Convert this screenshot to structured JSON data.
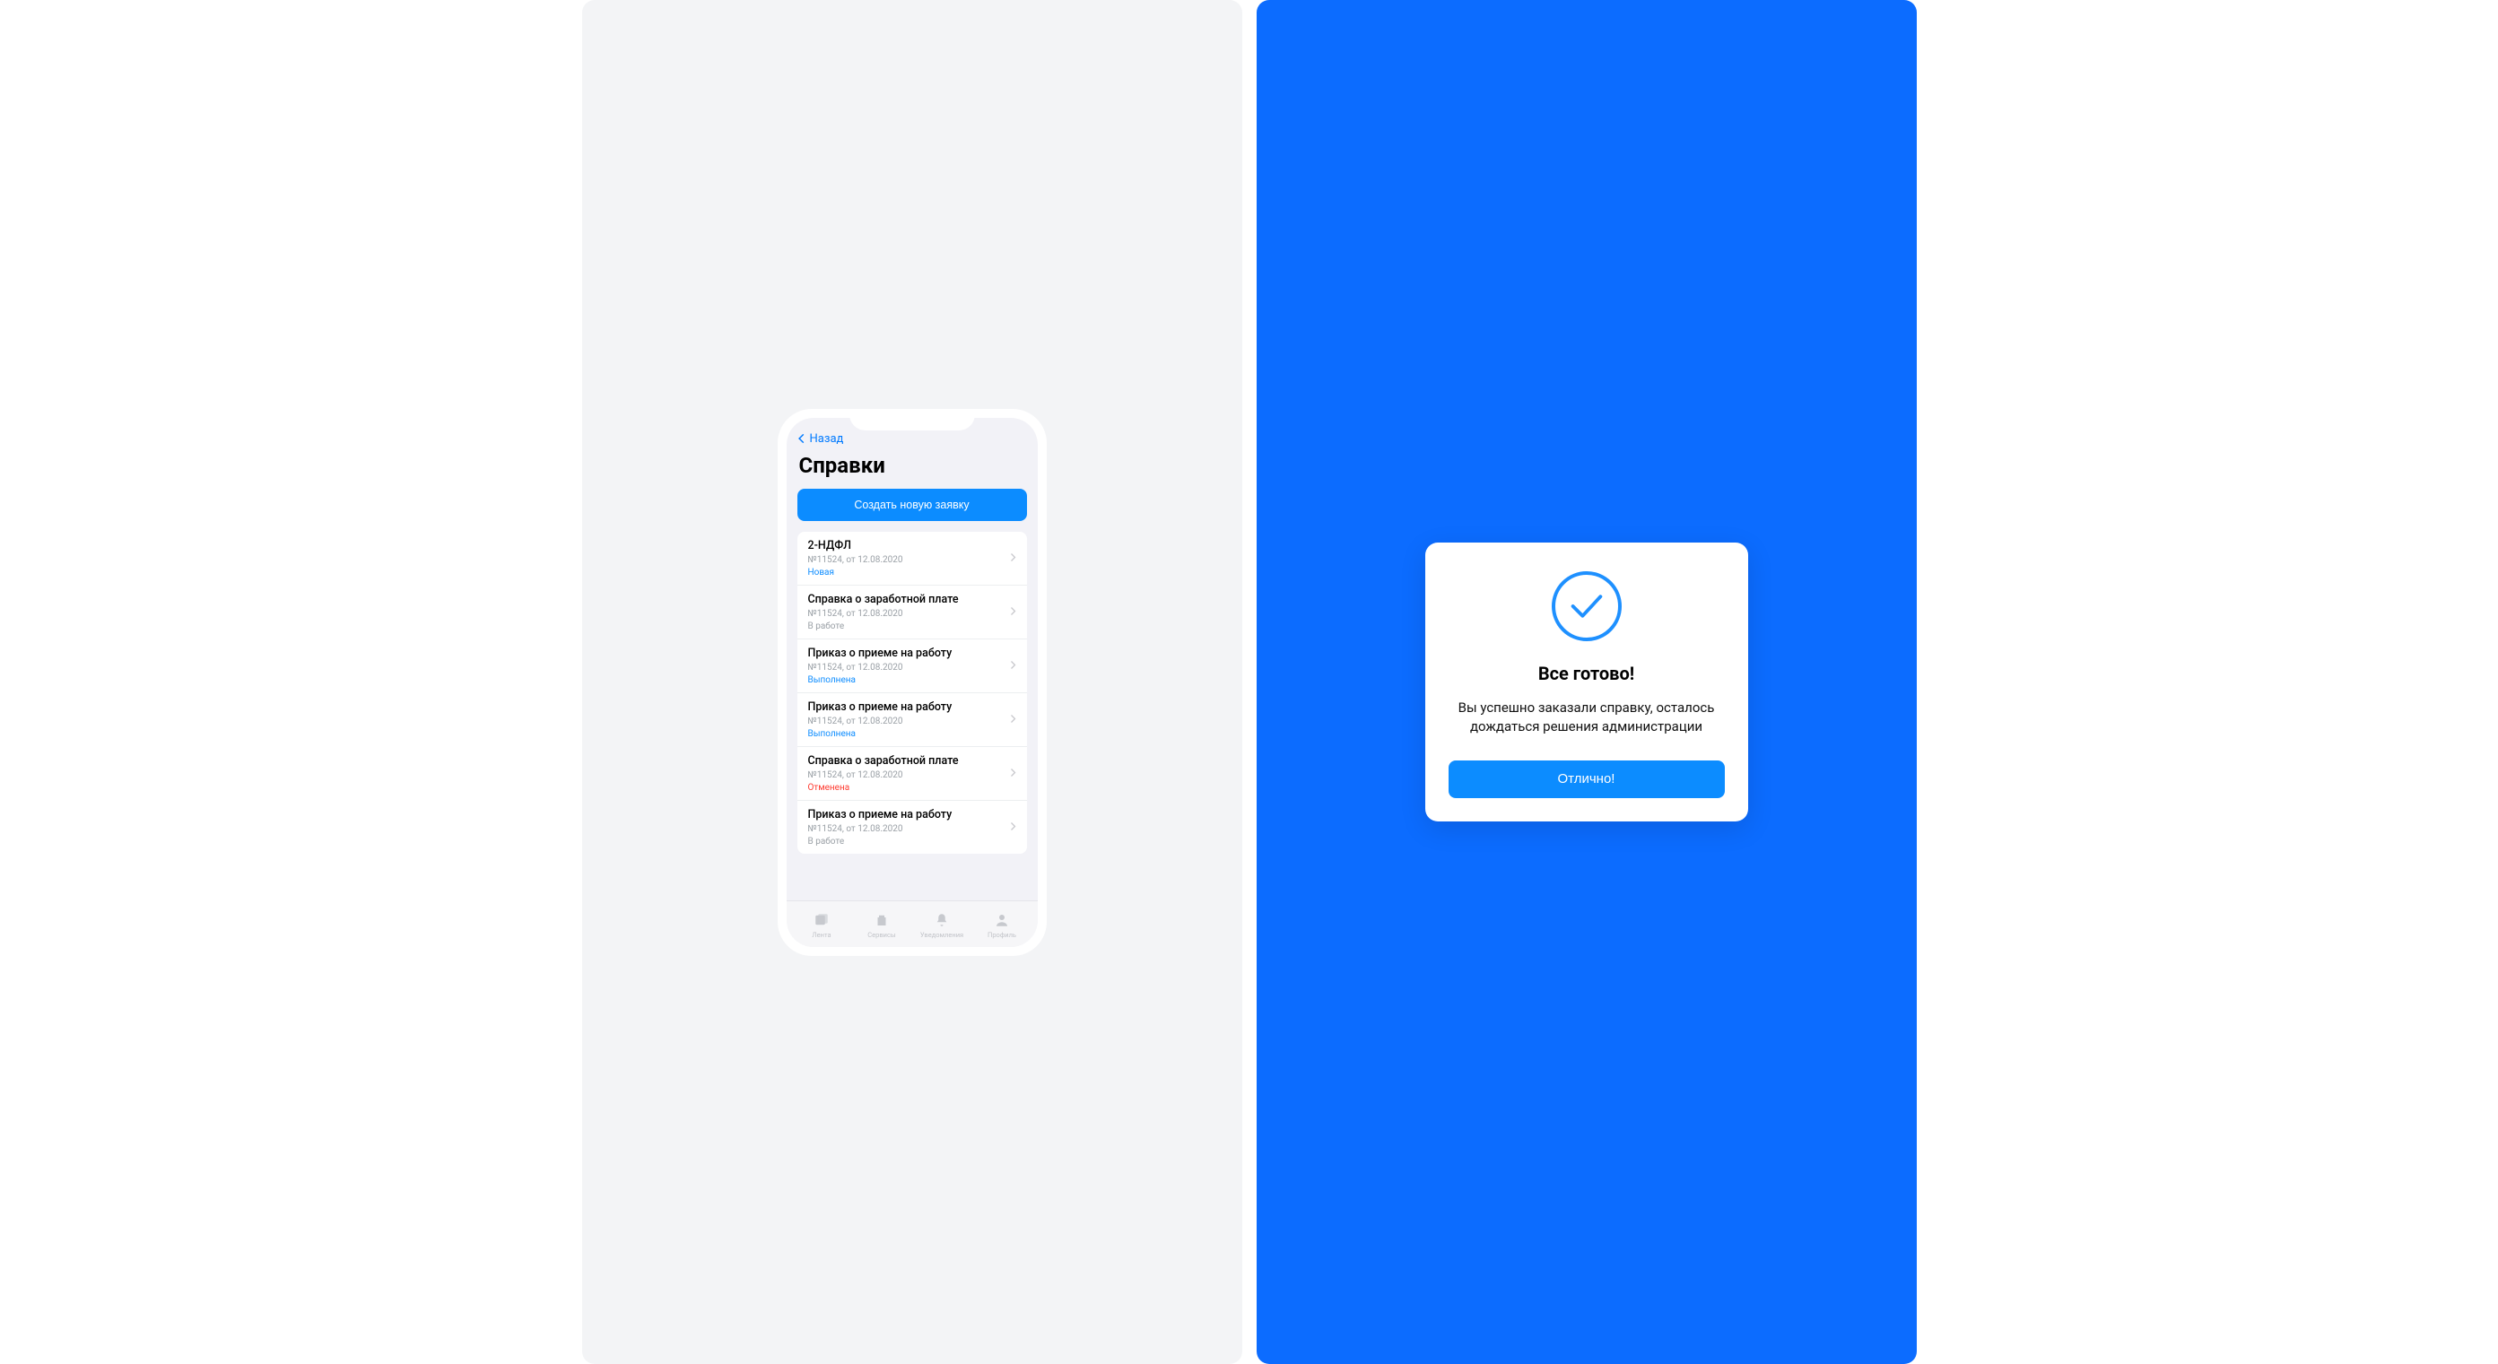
{
  "colors": {
    "accent": "#0c8cff",
    "panel_bg": "#0c6cff",
    "ios_blue": "#007aff",
    "red": "#ff3b30",
    "gray": "#9aa0a6"
  },
  "phone": {
    "back_label": "Назад",
    "title": "Справки",
    "primary_button": "Создать новую заявку",
    "requests": [
      {
        "title": "2-НДФЛ",
        "subtitle": "№11524, от 12.08.2020",
        "status": "Новая",
        "status_style": "stat-blue"
      },
      {
        "title": "Справка о заработной плате",
        "subtitle": "№11524, от 12.08.2020",
        "status": "В работе",
        "status_style": "stat-gray"
      },
      {
        "title": "Приказ о приеме на работу",
        "subtitle": "№11524, от 12.08.2020",
        "status": "Выполнена",
        "status_style": "stat-blue"
      },
      {
        "title": "Приказ о приеме на работу",
        "subtitle": "№11524, от 12.08.2020",
        "status": "Выполнена",
        "status_style": "stat-blue"
      },
      {
        "title": "Справка о заработной плате",
        "subtitle": "№11524, от 12.08.2020",
        "status": "Отменена",
        "status_style": "stat-red"
      },
      {
        "title": "Приказ о приеме на работу",
        "subtitle": "№11524, от 12.08.2020",
        "status": "В работе",
        "status_style": "stat-gray"
      }
    ],
    "tabs": [
      {
        "label": "Лента",
        "icon": "feed"
      },
      {
        "label": "Сервисы",
        "icon": "services"
      },
      {
        "label": "Уведомления",
        "icon": "bell"
      },
      {
        "label": "Профиль",
        "icon": "profile"
      }
    ]
  },
  "modal": {
    "title": "Все готово!",
    "body": "Вы успешно заказали справку, осталось дождаться решения администрации",
    "button": "Отлично!"
  }
}
